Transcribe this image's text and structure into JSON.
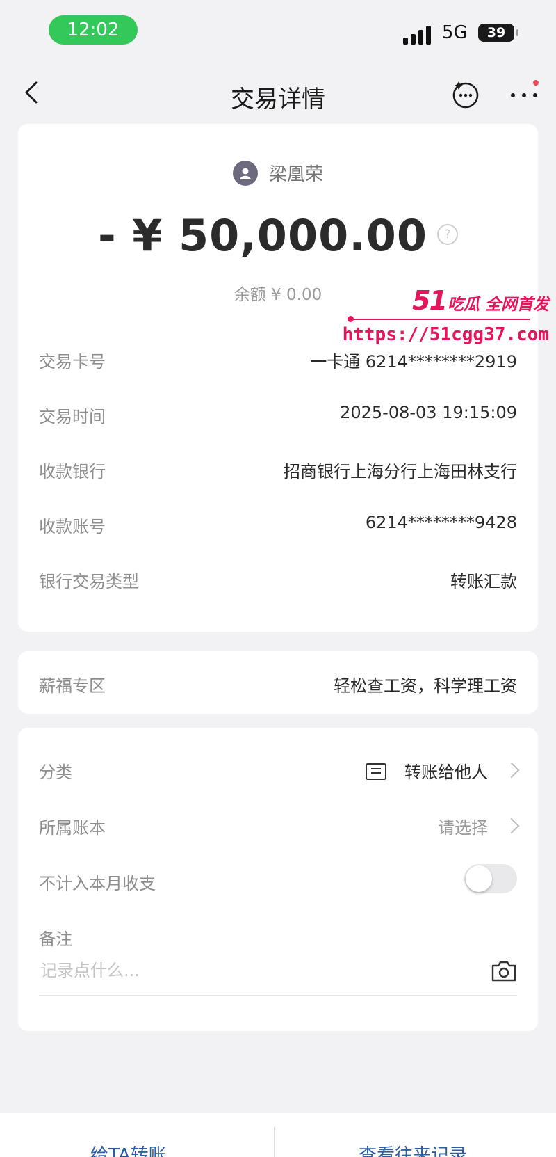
{
  "status_bar": {
    "time": "12:02",
    "network": "5G",
    "battery": "39"
  },
  "nav": {
    "title": "交易详情"
  },
  "summary": {
    "payee_name": "梁凰荣",
    "amount": "- ¥ 50,000.00",
    "help_glyph": "?",
    "balance": "余额 ¥ 0.00"
  },
  "details": [
    {
      "label": "交易卡号",
      "value": "一卡通 6214********2919"
    },
    {
      "label": "交易时间",
      "value": "2025-08-03 19:15:09"
    },
    {
      "label": "收款银行",
      "value": "招商银行上海分行上海田林支行"
    },
    {
      "label": "收款账号",
      "value": "6214********9428"
    },
    {
      "label": "银行交易类型",
      "value": "转账汇款"
    }
  ],
  "salary_zone": {
    "label": "薪福专区",
    "value": "轻松查工资，科学理工资"
  },
  "options": {
    "category_label": "分类",
    "category_value": "转账给他人",
    "ledger_label": "所属账本",
    "ledger_value": "请选择",
    "exclude_label": "不计入本月收支",
    "exclude_enabled": false,
    "note_label": "备注",
    "note_placeholder": "记录点什么..."
  },
  "watermark": {
    "brand": "51",
    "tag": "吃瓜 全网首发",
    "url": "https://51cgg37.com"
  },
  "bottom_bar": {
    "transfer_label": "给TA转账",
    "history_label": "查看往来记录"
  },
  "colors": {
    "accent_green": "#34c759",
    "watermark_pink": "#e8145b",
    "link_blue": "#2a5fa8"
  }
}
